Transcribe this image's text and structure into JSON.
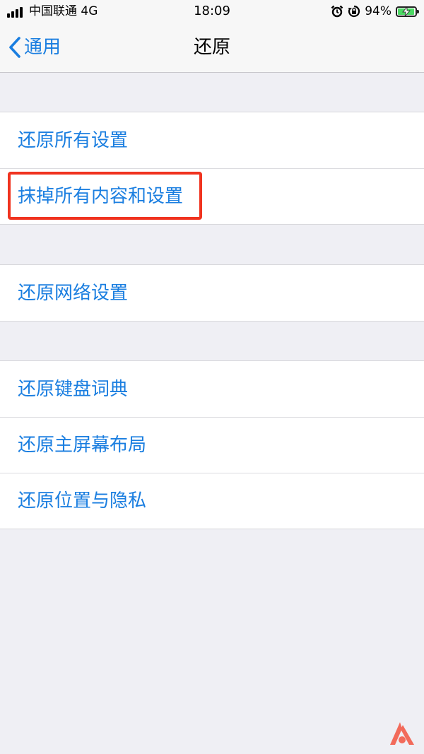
{
  "status_bar": {
    "carrier": "中国联通 4G",
    "time": "18:09",
    "battery_percent": "94%",
    "battery_level": 0.94,
    "icons": [
      "signal-icon",
      "alarm-icon",
      "orientation-lock-icon",
      "battery-charging-icon"
    ]
  },
  "nav": {
    "back_label": "通用",
    "title": "还原"
  },
  "groups": [
    {
      "items": [
        {
          "label": "还原所有设置"
        },
        {
          "label": "抹掉所有内容和设置",
          "highlighted": true
        }
      ]
    },
    {
      "items": [
        {
          "label": "还原网络设置"
        }
      ]
    },
    {
      "items": [
        {
          "label": "还原键盘词典"
        },
        {
          "label": "还原主屏幕布局"
        },
        {
          "label": "还原位置与隐私"
        }
      ]
    }
  ],
  "colors": {
    "accent": "#1a7ee0",
    "highlight": "#f0331f",
    "background": "#efeff4",
    "battery": "#4cd964"
  },
  "watermark": {
    "icon": "logo-a-icon"
  }
}
